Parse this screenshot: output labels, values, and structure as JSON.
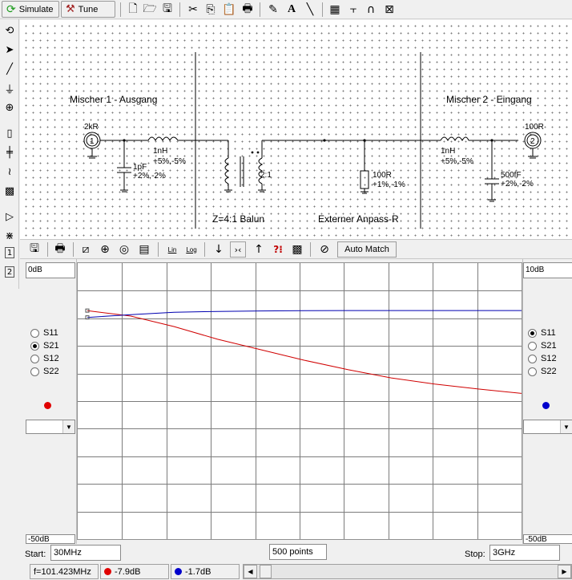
{
  "toolbar": {
    "simulate_label": "Simulate",
    "tune_label": "Tune",
    "icons": [
      "new-file-icon",
      "open-folder-icon",
      "save-icon",
      "cut-icon",
      "copy-icon",
      "paste-icon",
      "print-icon",
      "pencil-icon",
      "text-icon",
      "line-draw-icon",
      "calculator-icon",
      "tline-icon",
      "stub-icon",
      "smith-icon"
    ]
  },
  "schematic": {
    "title_left": "Mischer 1 - Ausgang",
    "title_right": "Mischer 2 - Eingang",
    "port1": {
      "number": "1",
      "impedance": "2kR"
    },
    "port2": {
      "number": "2",
      "impedance": "100R"
    },
    "l1": {
      "value": "1nH",
      "tolerance": "+5%,-5%"
    },
    "c1": {
      "value": "1pF",
      "tolerance": "+2%,-2%"
    },
    "transformer": {
      "ratio": "2:1",
      "caption": "Z=4:1 Balun"
    },
    "r1": {
      "value": "100R",
      "tolerance": "+1%,-1%",
      "caption": "Externer Anpass-R"
    },
    "l2": {
      "value": "1nH",
      "tolerance": "+5%,-5%"
    },
    "c2": {
      "value": "500fF",
      "tolerance": "+2%,-2%"
    }
  },
  "plot_toolbar": {
    "lin_label": "Lin",
    "log_label": "Log",
    "auto_match_label": "Auto Match"
  },
  "left_panel": {
    "top_value": "0dB",
    "bottom_value": "-50dB",
    "params": [
      "S11",
      "S21",
      "S12",
      "S22"
    ],
    "selected": "S21",
    "marker_color": "#e00000"
  },
  "right_panel": {
    "top_value": "10dB",
    "bottom_value": "-50dB",
    "params": [
      "S11",
      "S21",
      "S12",
      "S22"
    ],
    "selected": "S11",
    "marker_color": "#0000cc"
  },
  "sweep": {
    "start_label": "Start:",
    "start_value": "30MHz",
    "points": "500 points",
    "stop_label": "Stop:",
    "stop_value": "3GHz"
  },
  "status": {
    "frequency": "f=101.423MHz",
    "red_value": "-7.9dB",
    "blue_value": "-1.7dB"
  },
  "chart_data": {
    "type": "line",
    "x_range": [
      "30MHz",
      "3GHz"
    ],
    "grid": true,
    "series": [
      {
        "color": "#d00000",
        "axis": "left",
        "ylim": [
          -50,
          0
        ],
        "x": [
          0,
          0.1,
          0.2,
          0.3,
          0.4,
          0.5,
          0.6,
          0.7,
          0.8,
          0.9,
          1.0
        ],
        "y": [
          -8.6,
          -9.6,
          -11.5,
          -13.8,
          -15.7,
          -17.6,
          -19.3,
          -20.8,
          -21.9,
          -22.8,
          -23.6
        ]
      },
      {
        "color": "#0000b0",
        "axis": "right",
        "ylim": [
          -50,
          10
        ],
        "x": [
          0,
          0.1,
          0.2,
          0.3,
          0.4,
          0.5,
          0.6,
          0.7,
          0.8,
          0.9,
          1.0
        ],
        "y": [
          -1.8,
          -1.2,
          -0.7,
          -0.5,
          -0.4,
          -0.35,
          -0.3,
          -0.3,
          -0.3,
          -0.3,
          -0.3
        ]
      }
    ]
  }
}
